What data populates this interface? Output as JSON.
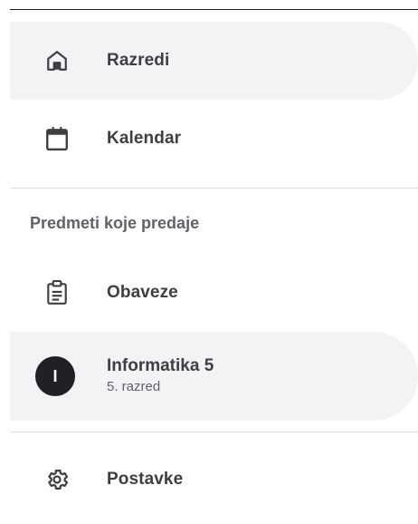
{
  "nav": {
    "classes_label": "Razredi",
    "calendar_label": "Kalendar",
    "section_heading": "Predmeti koje predaje",
    "todo_label": "Obaveze",
    "course": {
      "avatar_letter": "I",
      "title": "Informatika 5",
      "subtitle": "5. razred"
    },
    "settings_label": "Postavke"
  },
  "icons": {
    "classes": "home-icon",
    "calendar": "calendar-icon",
    "todo": "clipboard-icon",
    "settings": "gear-icon"
  },
  "colors": {
    "active_background": "#f1f3f4",
    "icon": "#3c4043",
    "avatar_background": "#202124"
  }
}
